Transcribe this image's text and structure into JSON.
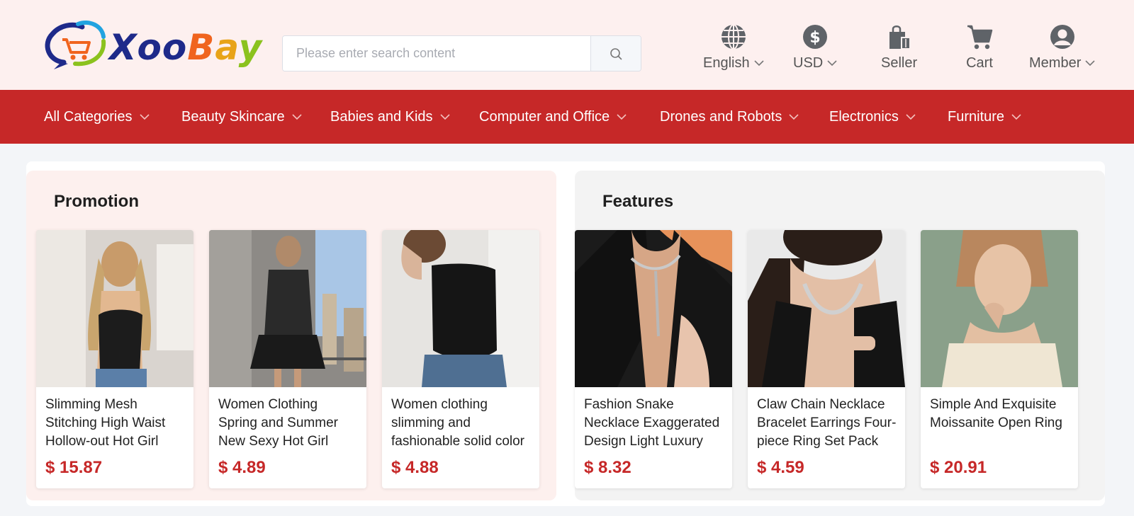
{
  "brand": {
    "name": "XooBay"
  },
  "search": {
    "placeholder": "Please enter search content"
  },
  "header_actions": [
    {
      "id": "language",
      "label": "English",
      "icon": "globe-icon",
      "dropdown": true
    },
    {
      "id": "currency",
      "label": "USD",
      "icon": "dollar-coin-icon",
      "dropdown": true
    },
    {
      "id": "seller",
      "label": "Seller",
      "icon": "shopping-bag-icon",
      "dropdown": false
    },
    {
      "id": "cart",
      "label": "Cart",
      "icon": "cart-icon",
      "dropdown": false
    },
    {
      "id": "member",
      "label": "Member",
      "icon": "user-avatar-icon",
      "dropdown": true
    }
  ],
  "nav": {
    "items": [
      {
        "label": "All Categories"
      },
      {
        "label": "Beauty Skincare"
      },
      {
        "label": "Babies and Kids"
      },
      {
        "label": "Computer and Office"
      },
      {
        "label": "Drones and Robots"
      },
      {
        "label": "Electronics"
      },
      {
        "label": "Furniture"
      }
    ]
  },
  "promotion": {
    "title": "Promotion",
    "products": [
      {
        "name": "Slimming Mesh Stitching High Waist Hollow-out Hot Girl",
        "price": "$ 15.87"
      },
      {
        "name": "Women Clothing Spring and Summer New Sexy Hot Girl",
        "price": "$ 4.89"
      },
      {
        "name": "Women clothing slimming and fashionable solid color",
        "price": "$ 4.88"
      }
    ]
  },
  "features": {
    "title": "Features",
    "products": [
      {
        "name": "Fashion Snake Necklace Exaggerated Design Light Luxury",
        "price": "$ 8.32"
      },
      {
        "name": "Claw Chain Necklace Bracelet Earrings Four-piece Ring Set Pack",
        "price": "$ 4.59"
      },
      {
        "name": "Simple And Exquisite Moissanite Open Ring",
        "price": "$ 20.91"
      }
    ]
  },
  "colors": {
    "header_bg": "#fdf0ef",
    "nav_bg": "#c62828",
    "price": "#c62828",
    "promo_bg": "#fdf0ee",
    "feat_bg": "#f3f3f3"
  }
}
